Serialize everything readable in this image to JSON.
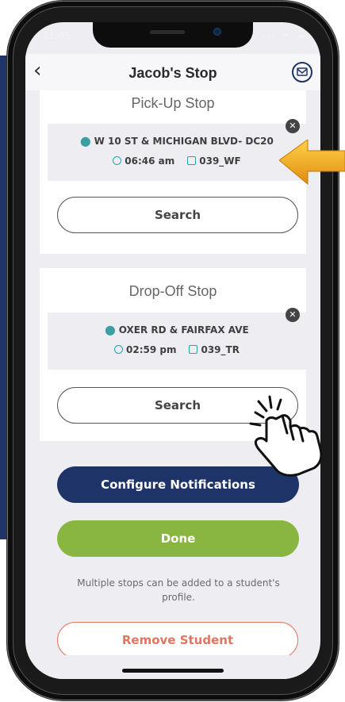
{
  "status": {
    "time": "11:05",
    "signal": "ııl ᯤ ▬"
  },
  "header": {
    "title": "Jacob's Stop",
    "back_icon": "chevron-left",
    "mail_icon": "envelope"
  },
  "pickup": {
    "title": "Pick-Up Stop",
    "stop_name": "W 10 ST & MICHIGAN BLVD- DC20",
    "time": "06:46 am",
    "route": "039_WF",
    "search_label": "Search"
  },
  "dropoff": {
    "title": "Drop-Off Stop",
    "stop_name": "OXER RD & FAIRFAX AVE",
    "time": "02:59 pm",
    "route": "039_TR",
    "search_label": "Search"
  },
  "actions": {
    "configure_label": "Configure Notifications",
    "done_label": "Done",
    "helper_text": "Multiple stops can be added to a student's profile.",
    "remove_label": "Remove Student"
  },
  "colors": {
    "navy": "#1e3368",
    "green": "#88b640",
    "remove": "#e2755f",
    "teal": "#2aa0b0",
    "arrow": "#f2a81d"
  }
}
